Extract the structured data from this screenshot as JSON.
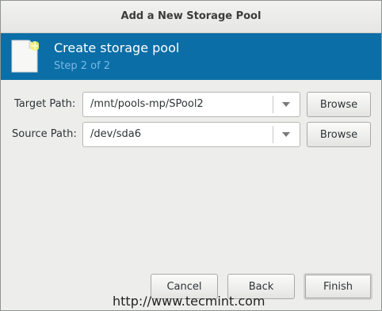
{
  "window": {
    "title": "Add a New Storage Pool"
  },
  "banner": {
    "title": "Create storage pool",
    "subtitle": "Step 2 of 2",
    "icon": "new-document-icon",
    "background_color": "#0b6ea7"
  },
  "form": {
    "target_path": {
      "label": "Target Path:",
      "value": "/mnt/pools-mp/SPool2",
      "browse_label": "Browse"
    },
    "source_path": {
      "label": "Source Path:",
      "value": "/dev/sda6",
      "browse_label": "Browse"
    }
  },
  "footer": {
    "cancel_label": "Cancel",
    "back_label": "Back",
    "finish_label": "Finish"
  },
  "watermark": {
    "text": "http://www.tecmint.com"
  }
}
